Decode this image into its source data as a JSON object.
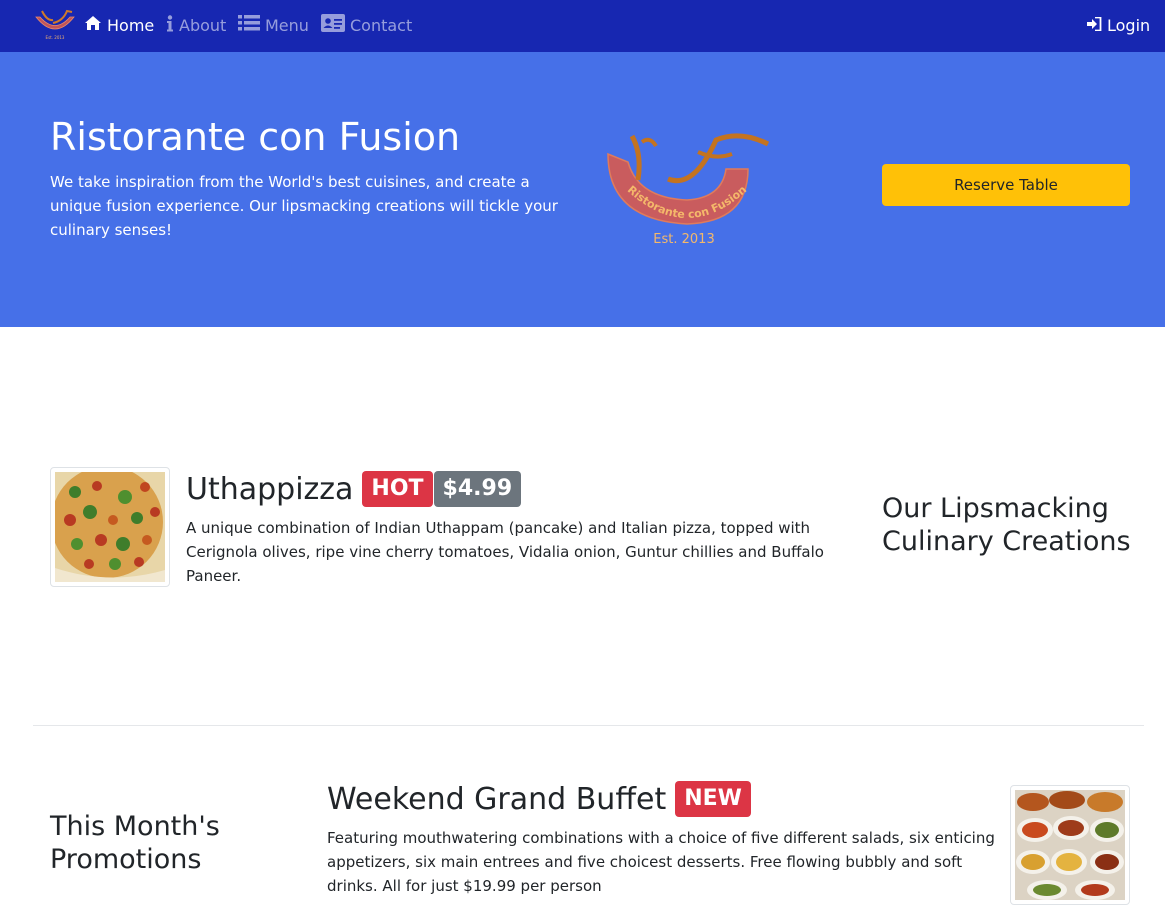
{
  "nav": {
    "home_label": "Home",
    "about_label": "About",
    "menu_label": "Menu",
    "contact_label": "Contact",
    "login_label": "Login",
    "logo_text": "Est. 2013"
  },
  "jumbotron": {
    "title": "Ristorante con Fusion",
    "text": "We take inspiration from the World's best cuisines, and create a unique fusion experience. Our lipsmacking creations will tickle your culinary senses!",
    "logo_arc_text": "Ristorante con Fusion",
    "logo_est_text": "Est. 2013",
    "reserve_label": "Reserve Table"
  },
  "dish": {
    "name": "Uthappizza",
    "badge_label": "HOT",
    "price_label": "$4.99",
    "description": "A unique combination of Indian Uthappam (pancake) and Italian pizza, topped with Cerignola olives, ripe vine cherry tomatoes, Vidalia onion, Guntur chillies and Buffalo Paneer."
  },
  "dish_heading": "Our Lipsmacking Culinary Creations",
  "promotion": {
    "heading": "This Month's Promotions",
    "name": "Weekend Grand Buffet",
    "badge_label": "NEW",
    "description": "Featuring mouthwatering combinations with a choice of five different salads, six enticing appetizers, six main entrees and five choicest desserts. Free flowing bubbly and soft drinks. All for just $19.99 per person"
  },
  "colors": {
    "navbar": "#1727b1",
    "jumbotron": "#4670e8",
    "reserve_button": "#ffc107",
    "badge_danger": "#dc3545",
    "badge_secondary": "#6c757d"
  },
  "icons": {
    "home": "home-icon",
    "about": "info-icon",
    "menu": "list-icon",
    "contact": "address-card-icon",
    "login": "sign-in-icon"
  }
}
